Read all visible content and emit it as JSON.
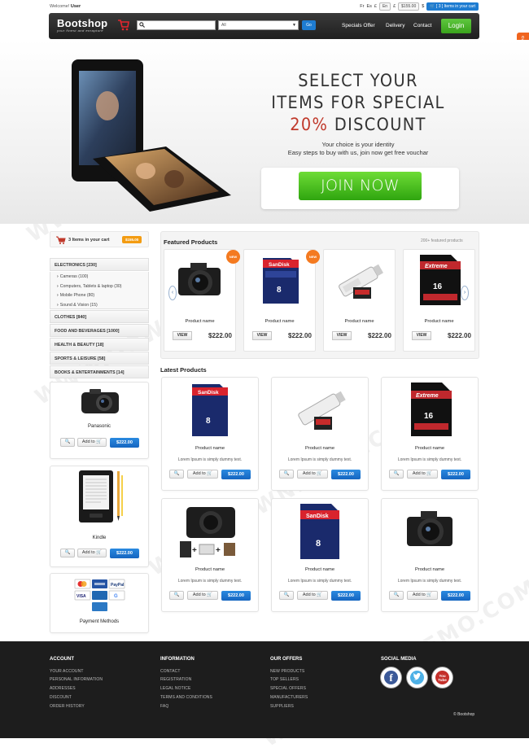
{
  "topbar": {
    "welcome_prefix": "Welcome!",
    "welcome_user": "User",
    "lang_fr": "Fr",
    "lang_es": "Es",
    "currency_symbol": "£",
    "en_pill": "En",
    "price_pill": "$155.00",
    "dollar": "$",
    "cart_pill": "[ 3 ] Items in your cart"
  },
  "navbar": {
    "logo": "Bootshop",
    "tagline": "your finest and enrapture",
    "search_placeholder": "",
    "category_selected": "All",
    "go_label": "Go",
    "links": [
      "Specials Offer",
      "Delivery",
      "Contact"
    ],
    "login_label": "Login"
  },
  "customize_tab": "Customize",
  "hero": {
    "line1": "SELECT YOUR",
    "line2": "ITEMS FOR SPECIAL",
    "line3_red": "20%",
    "line3_rest": " DISCOUNT",
    "sub1": "Your choice is your identity",
    "sub2": "Easy steps to buy with us, join now get free vouchar",
    "join_label": "JOIN NOW"
  },
  "sidebar": {
    "cart_text": "3 Items in your cart",
    "cart_price": "$155.00",
    "categories": [
      {
        "label": "ELECTRONICS [230]",
        "subs": [
          "Cameras (100)",
          "Computers, Tablets & laptop (30)",
          "Mobile Phone (80)",
          "Sound & Vision (15)"
        ]
      },
      {
        "label": "CLOTHES [840]",
        "subs": []
      },
      {
        "label": "FOOD AND BEVERAGES [1000]",
        "subs": []
      },
      {
        "label": "HEALTH & BEAUTY [18]",
        "subs": []
      },
      {
        "label": "SPORTS & LEISURE [58]",
        "subs": []
      },
      {
        "label": "BOOKS & ENTERTAINMENTS [14]",
        "subs": []
      }
    ],
    "products": [
      {
        "name": "Panasonic",
        "add": "Add to",
        "price": "$222.00"
      },
      {
        "name": "Kindle",
        "add": "Add to",
        "price": "$222.00"
      }
    ],
    "payment_label": "Payment Methods"
  },
  "featured": {
    "title": "Featured Products",
    "count": "200+ featured products",
    "new_badge": "NEW",
    "items": [
      {
        "name": "Product name",
        "view": "VIEW",
        "price": "$222.00"
      },
      {
        "name": "Product name",
        "view": "VIEW",
        "price": "$222.00"
      },
      {
        "name": "Product name",
        "view": "VIEW",
        "price": "$222.00"
      },
      {
        "name": "Product name",
        "view": "VIEW",
        "price": "$222.00"
      }
    ]
  },
  "latest": {
    "title": "Latest Products",
    "items": [
      {
        "name": "Product name",
        "desc": "Lorem Ipsum is simply dummy text.",
        "add": "Add to",
        "price": "$222.00"
      },
      {
        "name": "Product name",
        "desc": "Lorem Ipsum is simply dummy text.",
        "add": "Add to",
        "price": "$222.00"
      },
      {
        "name": "Product name",
        "desc": "Lorem Ipsum is simply dummy text.",
        "add": "Add to",
        "price": "$222.00"
      },
      {
        "name": "Product name",
        "desc": "Lorem Ipsum is simply dummy text.",
        "add": "Add to",
        "price": "$222.00"
      },
      {
        "name": "Product name",
        "desc": "Lorem Ipsum is simply dummy text.",
        "add": "Add to",
        "price": "$222.00"
      },
      {
        "name": "Product name",
        "desc": "Lorem Ipsum is simply dummy text.",
        "add": "Add to",
        "price": "$222.00"
      }
    ]
  },
  "footer": {
    "account": {
      "title": "ACCOUNT",
      "links": [
        "YOUR ACCOUNT",
        "PERSONAL INFORMATION",
        "ADDRESSES",
        "DISCOUNT",
        "ORDER HISTORY"
      ]
    },
    "information": {
      "title": "INFORMATION",
      "links": [
        "CONTACT",
        "REGISTRATION",
        "LEGAL NOTICE",
        "TERMS AND CONDITIONS",
        "FAQ"
      ]
    },
    "offers": {
      "title": "OUR OFFERS",
      "links": [
        "NEW PRODUCTS",
        "TOP SELLERS",
        "SPECIAL OFFERS",
        "MANUFACTURERS",
        "SUPPLIERS"
      ]
    },
    "social": {
      "title": "SOCIAL MEDIA",
      "fb": "f",
      "yt": "You Tube"
    },
    "copyright": "© Bootshop"
  },
  "colors": {
    "accent_blue": "#1e7cd1",
    "green": "#3aa21c",
    "orange": "#f39c12",
    "red": "#c0392b"
  }
}
